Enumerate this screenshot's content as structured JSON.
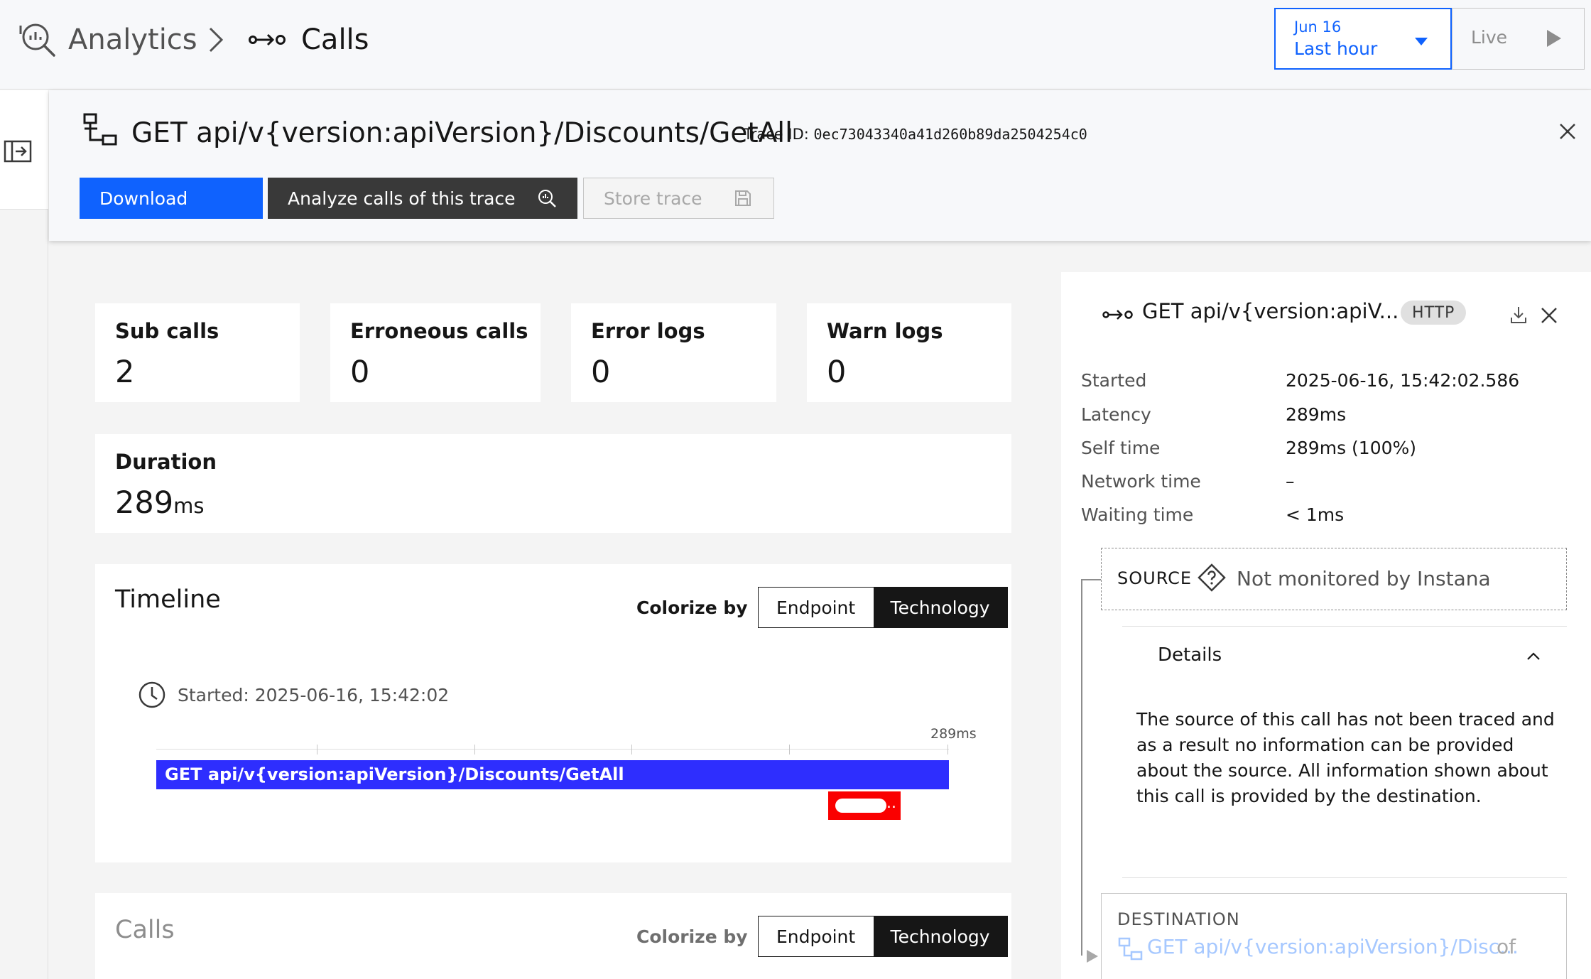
{
  "breadcrumb": {
    "analytics": "Analytics",
    "calls": "Calls"
  },
  "time_picker": {
    "date": "Jun 16",
    "range": "Last hour",
    "live": "Live"
  },
  "trace": {
    "title": "GET api/v{version:apiVersion}/Discounts/GetAll",
    "id_label": "Trace ID:",
    "id_value": "0ec73043340a41d260b89da2504254c0",
    "buttons": {
      "download": "Download",
      "analyze": "Analyze calls of this trace",
      "store": "Store trace"
    }
  },
  "kpis": {
    "sub_calls": {
      "label": "Sub calls",
      "value": "2"
    },
    "erroneous_calls": {
      "label": "Erroneous calls",
      "value": "0"
    },
    "error_logs": {
      "label": "Error logs",
      "value": "0"
    },
    "warn_logs": {
      "label": "Warn logs",
      "value": "0"
    },
    "duration": {
      "label": "Duration",
      "value": "289",
      "unit": "ms"
    }
  },
  "timeline": {
    "title": "Timeline",
    "colorize_label": "Colorize by",
    "options": {
      "endpoint": "Endpoint",
      "technology": "Technology"
    },
    "selected": "Technology",
    "started": "Started: 2025-06-16, 15:42:02",
    "end_label": "289ms",
    "bar_label": "GET api/v{version:apiVersion}/Discounts/GetAll",
    "sub_span_label": "...",
    "colors": {
      "span": "#2e2efe",
      "sub_span": "#fa0000"
    }
  },
  "calls_section": {
    "title": "Calls",
    "colorize_label": "Colorize by",
    "options": {
      "endpoint": "Endpoint",
      "technology": "Technology"
    }
  },
  "detail": {
    "title": "GET api/v{version:apiV...",
    "tag": "HTTP",
    "fields": [
      {
        "label": "Started",
        "value": "2025-06-16, 15:42:02.586"
      },
      {
        "label": "Latency",
        "value": "289ms"
      },
      {
        "label": "Self time",
        "value": "289ms (100%)"
      },
      {
        "label": "Network time",
        "value": "–"
      },
      {
        "label": "Waiting time",
        "value": "< 1ms"
      }
    ],
    "source": {
      "label": "SOURCE",
      "text": "Not monitored by Instana"
    },
    "details": {
      "label": "Details",
      "body": "The source of this call has not been traced and as a result no information can be provided about the source. All information shown about this call is provided by the destination."
    },
    "destination": {
      "label": "DESTINATION",
      "link": "GET api/v{version:apiVersion}/Disc...",
      "of": "of"
    }
  }
}
